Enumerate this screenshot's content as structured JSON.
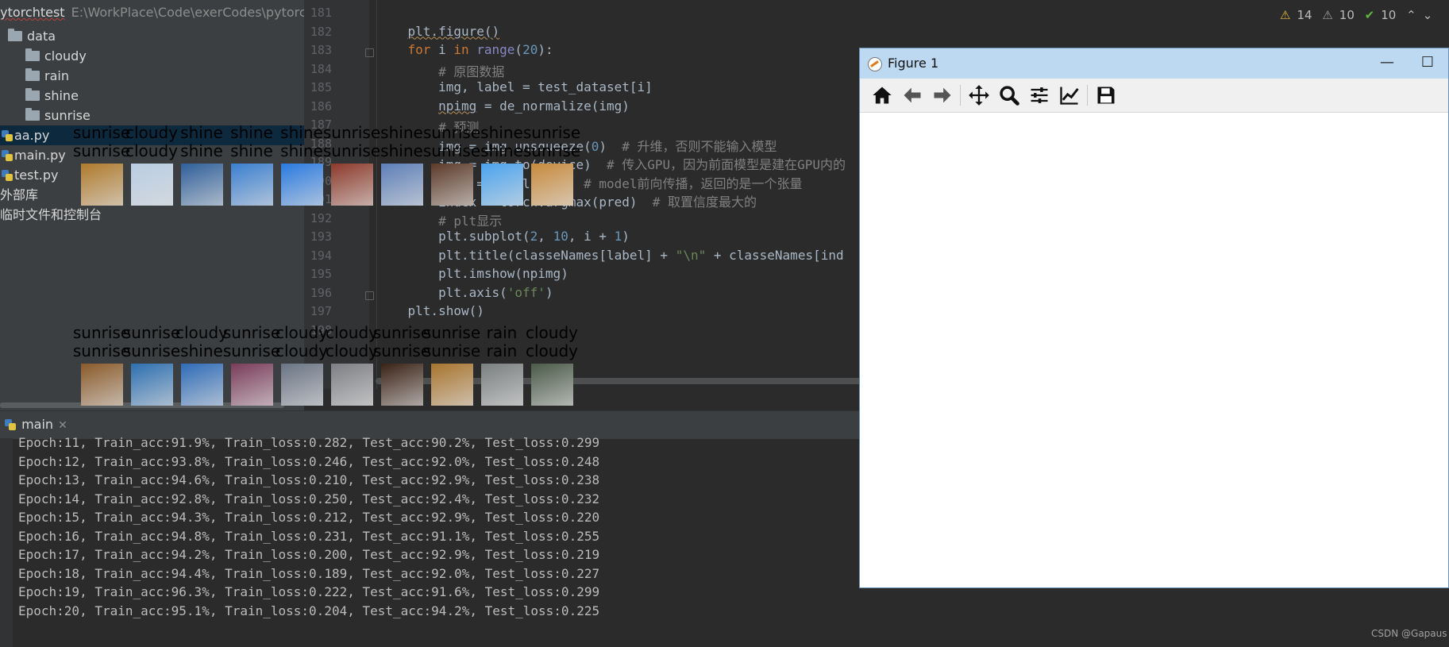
{
  "project": {
    "name": "pytorchtest",
    "path": "E:\\WorkPlace\\Code\\exerCodes\\pytorchte",
    "items": [
      {
        "label": "data",
        "kind": "folder"
      },
      {
        "label": "cloudy",
        "kind": "folder"
      },
      {
        "label": "rain",
        "kind": "folder"
      },
      {
        "label": "shine",
        "kind": "folder"
      },
      {
        "label": "sunrise",
        "kind": "folder"
      },
      {
        "label": "aa.py",
        "kind": "py"
      },
      {
        "label": "main.py",
        "kind": "py"
      },
      {
        "label": "test.py",
        "kind": "py"
      },
      {
        "label": "外部库",
        "kind": "lib"
      },
      {
        "label": "临时文件和控制台",
        "kind": "scratch"
      }
    ],
    "selected": "aa.py"
  },
  "editor": {
    "line_numbers": [
      "181",
      "182",
      "183",
      "184",
      "185",
      "186",
      "187",
      "188",
      "189",
      "190",
      "191",
      "192",
      "193",
      "194",
      "195",
      "196",
      "197",
      "198"
    ],
    "lines": [
      "",
      "    plt.figure()",
      "    for i in range(20):",
      "        # 原图数据",
      "        img, label = test_dataset[i]",
      "        npimg = de_normalize(img)",
      "        # 预测",
      "        img = img.unsqueeze(0)  # 升维，否则不能输入模型",
      "        img = img.to(device)  # 传入GPU，因为前面模型是建在GPU内的",
      "        pred = model(img)  # model前向传播，返回的是一个张量",
      "        index = torch.argmax(pred)  # 取置信度最大的",
      "        # plt显示",
      "        plt.subplot(2, 10, i + 1)",
      "        plt.title(classeNames[label] + \"\\n\" + classeNames[ind",
      "        plt.imshow(npimg)",
      "        plt.axis('off')",
      "    plt.show()",
      ""
    ]
  },
  "inspections": {
    "warnings": "14",
    "weak_warnings": "10",
    "ok": "10"
  },
  "run": {
    "tab_label": "main",
    "output": [
      "Epoch:11, Train_acc:91.9%, Train_loss:0.282, Test_acc:90.2%, Test_loss:0.299",
      "Epoch:12, Train_acc:93.8%, Train_loss:0.246, Test_acc:92.0%, Test_loss:0.248",
      "Epoch:13, Train_acc:94.6%, Train_loss:0.210, Test_acc:92.9%, Test_loss:0.238",
      "Epoch:14, Train_acc:92.8%, Train_loss:0.250, Test_acc:92.4%, Test_loss:0.232",
      "Epoch:15, Train_acc:94.3%, Train_loss:0.212, Test_acc:92.9%, Test_loss:0.220",
      "Epoch:16, Train_acc:94.8%, Train_loss:0.231, Test_acc:91.1%, Test_loss:0.255",
      "Epoch:17, Train_acc:94.2%, Train_loss:0.200, Test_acc:92.9%, Test_loss:0.219",
      "Epoch:18, Train_acc:94.4%, Train_loss:0.189, Test_acc:92.0%, Test_loss:0.227",
      "Epoch:19, Train_acc:96.3%, Train_loss:0.222, Test_acc:91.6%, Test_loss:0.299",
      "Epoch:20, Train_acc:95.1%, Train_loss:0.204, Test_acc:94.2%, Test_loss:0.225"
    ]
  },
  "figure": {
    "title": "Figure 1",
    "minimize": "—",
    "maximize": "☐",
    "toolbar": [
      "home-icon",
      "back-icon",
      "forward-icon",
      "pan-icon",
      "zoom-icon",
      "configure-subplots-icon",
      "edit-axes-icon",
      "save-icon"
    ],
    "subplots": [
      {
        "label": "sunrise",
        "pred": "sunrise",
        "color": "#b07a2c"
      },
      {
        "label": "cloudy",
        "pred": "cloudy",
        "color": "#b9cde3"
      },
      {
        "label": "shine",
        "pred": "shine",
        "color": "#2f5f9a"
      },
      {
        "label": "shine",
        "pred": "shine",
        "color": "#3a7fd0"
      },
      {
        "label": "shine",
        "pred": "shine",
        "color": "#2a7ae0"
      },
      {
        "label": "sunrise",
        "pred": "sunrise",
        "color": "#8c3a2a"
      },
      {
        "label": "shine",
        "pred": "shine",
        "color": "#5d7fb8"
      },
      {
        "label": "sunrise",
        "pred": "sunrise",
        "color": "#5b3a28"
      },
      {
        "label": "shine",
        "pred": "shine",
        "color": "#4aa3ef"
      },
      {
        "label": "sunrise",
        "pred": "sunrise",
        "color": "#c88a3c"
      },
      {
        "label": "sunrise",
        "pred": "sunrise",
        "color": "#8a5a2a"
      },
      {
        "label": "sunrise",
        "pred": "sunrise",
        "color": "#2d6fb0"
      },
      {
        "label": "cloudy",
        "pred": "shine",
        "color": "#2f6cb8"
      },
      {
        "label": "sunrise",
        "pred": "sunrise",
        "color": "#7a3c5a"
      },
      {
        "label": "cloudy",
        "pred": "cloudy",
        "color": "#6a7484"
      },
      {
        "label": "cloudy",
        "pred": "cloudy",
        "color": "#7d7f84"
      },
      {
        "label": "sunrise",
        "pred": "sunrise",
        "color": "#3a2216"
      },
      {
        "label": "sunrise",
        "pred": "sunrise",
        "color": "#a8742e"
      },
      {
        "label": "rain",
        "pred": "rain",
        "color": "#7a7f80"
      },
      {
        "label": "cloudy",
        "pred": "cloudy",
        "color": "#4a5a48"
      }
    ]
  },
  "watermark": "CSDN @Gapaus"
}
